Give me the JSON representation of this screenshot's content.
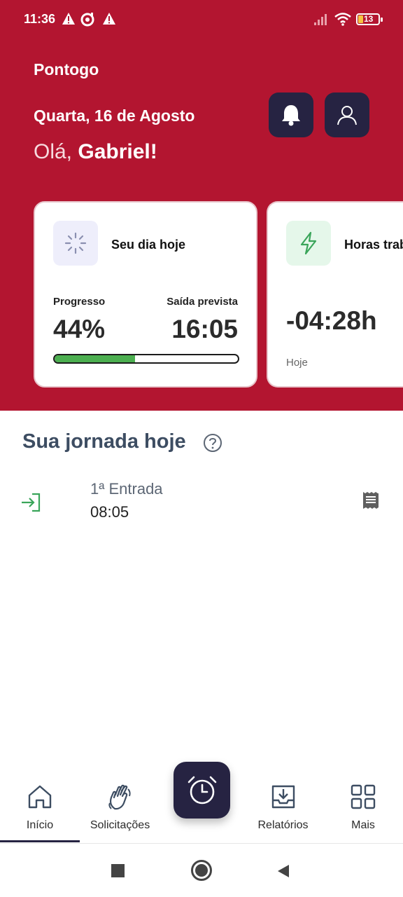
{
  "status_bar": {
    "time": "11:36",
    "left_icons": [
      "warning-icon",
      "data-saver-icon",
      "warning-icon"
    ],
    "right_icons": [
      "signal-icon",
      "wifi-icon",
      "battery-icon"
    ],
    "battery_level": "13"
  },
  "header": {
    "app_name": "Pontogo",
    "date": "Quarta, 16 de Agosto",
    "greeting_prefix": "Olá, ",
    "user_name": "Gabriel!",
    "notification_icon": "bell-icon",
    "profile_icon": "user-icon",
    "background_color": "#b31530"
  },
  "cards": [
    {
      "title": "Seu dia hoje",
      "icon": "loading-spinner-icon",
      "progress_label": "Progresso",
      "progress_value": "44%",
      "progress_fraction": 0.44,
      "exit_label": "Saída prevista",
      "exit_value": "16:05"
    },
    {
      "title": "Horas trab",
      "icon": "lightning-icon",
      "value": "-04:28h",
      "sub_label": "Hoje"
    }
  ],
  "journey": {
    "title": "Sua jornada hoje",
    "help_icon": "help-circle-icon",
    "entries": [
      {
        "label": "1ª Entrada",
        "time": "08:05",
        "icon": "sign-in-icon",
        "action_icon": "receipt-icon"
      }
    ]
  },
  "tabbar": {
    "tabs": [
      {
        "label": "Início",
        "icon": "home-icon",
        "active": true
      },
      {
        "label": "Solicitações",
        "icon": "waving-hand-icon",
        "active": false
      },
      {
        "label": "Relatórios",
        "icon": "download-tray-icon",
        "active": false
      },
      {
        "label": "Mais",
        "icon": "grid-icon",
        "active": false
      }
    ],
    "center_action_icon": "alarm-clock-icon"
  },
  "system_nav": [
    "recents-button",
    "home-button",
    "back-button"
  ],
  "colors": {
    "accent": "#b31530",
    "dark": "#262342",
    "progress_fill": "#4caf50",
    "title_text": "#3d4d62"
  }
}
